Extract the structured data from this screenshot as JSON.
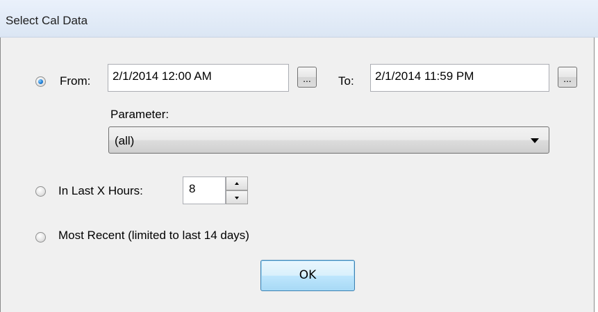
{
  "window": {
    "title": "Select Cal Data"
  },
  "range_option": {
    "label": "From:",
    "selected": true,
    "from_value": "2/1/2014 12:00 AM",
    "to_label": "To:",
    "to_value": "2/1/2014 11:59 PM",
    "browse_label": "..."
  },
  "parameter": {
    "label": "Parameter:",
    "selected": "(all)"
  },
  "hours_option": {
    "label": "In Last X Hours:",
    "selected": false,
    "value": "8"
  },
  "recent_option": {
    "label": "Most Recent  (limited to last 14 days)",
    "selected": false
  },
  "ok_button": {
    "label": "OK"
  }
}
